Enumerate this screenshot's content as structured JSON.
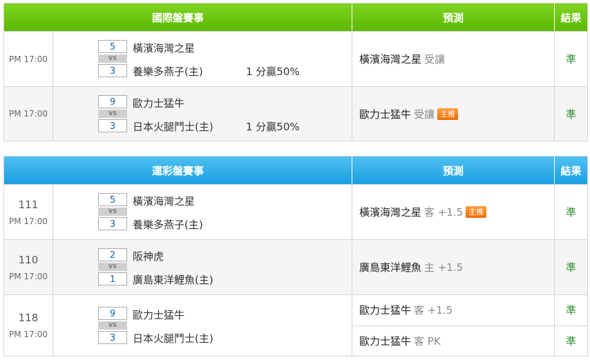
{
  "intl": {
    "header": {
      "title": "國際盤賽事",
      "prediction": "預測",
      "result": "結果"
    },
    "rows": [
      {
        "time": "PM 17:00",
        "score_top": "5",
        "score_bottom": "3",
        "vs": "VS",
        "team_top": "橫濱海灣之星",
        "team_bottom": "養樂多燕子(主)",
        "odds": "1 分贏50%",
        "pred_team": "橫濱海灣之星",
        "pred_detail": "受讓",
        "badge": "",
        "result": "準"
      },
      {
        "time": "PM 17:00",
        "score_top": "9",
        "score_bottom": "3",
        "vs": "VS",
        "team_top": "歐力士猛牛",
        "team_bottom": "日本火腿鬥士(主)",
        "odds": "1 分贏50%",
        "pred_team": "歐力士猛牛",
        "pred_detail": "受讓",
        "badge": "主推",
        "result": "準"
      }
    ]
  },
  "sports": {
    "header": {
      "title": "運彩盤賽事",
      "prediction": "預測",
      "result": "結果"
    },
    "rows": [
      {
        "num": "111",
        "time": "PM 17:00",
        "score_top": "5",
        "score_bottom": "3",
        "vs": "VS",
        "team_top": "橫濱海灣之星",
        "team_bottom": "養樂多燕子(主)",
        "preds": [
          {
            "team": "橫濱海灣之星",
            "detail": "客 +1.5",
            "badge": "主推",
            "result": "準"
          }
        ]
      },
      {
        "num": "110",
        "time": "PM 17:00",
        "score_top": "2",
        "score_bottom": "1",
        "vs": "VS",
        "team_top": "阪神虎",
        "team_bottom": "廣島東洋鯉魚(主)",
        "preds": [
          {
            "team": "廣島東洋鯉魚",
            "detail": "主 +1.5",
            "badge": "",
            "result": "準"
          }
        ]
      },
      {
        "num": "118",
        "time": "PM 17:00",
        "score_top": "9",
        "score_bottom": "3",
        "vs": "VS",
        "team_top": "歐力士猛牛",
        "team_bottom": "日本火腿鬥士(主)",
        "preds": [
          {
            "team": "歐力士猛牛",
            "detail": "客 +1.5",
            "badge": "",
            "result": "準"
          },
          {
            "team": "歐力士猛牛",
            "detail": "客 PK",
            "badge": "",
            "result": "準"
          }
        ]
      }
    ]
  },
  "colors": {
    "green_header": "#6cc710",
    "blue_header": "#2aa8e8",
    "badge": "#f07a10",
    "result_text": "#2e8b2e",
    "score_text": "#1a5f9e"
  }
}
